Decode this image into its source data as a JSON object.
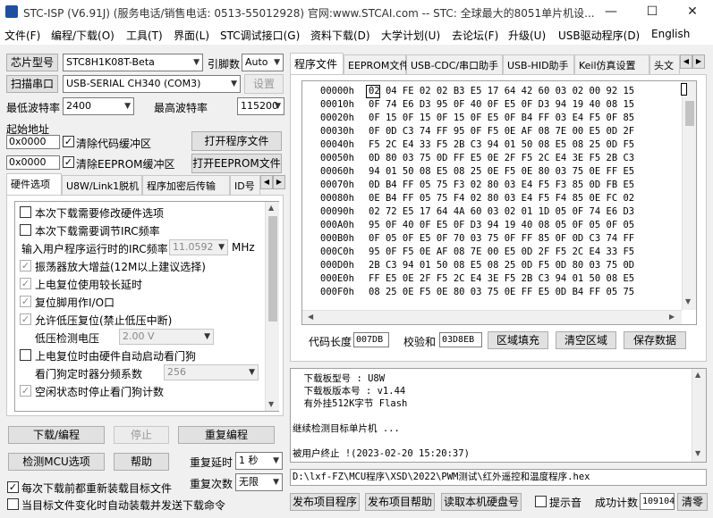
{
  "window": {
    "title": "STC-ISP (V6.91J) (服务电话/销售电话: 0513-55012928) 官网:www.STCAI.com  -- STC: 全球最大的8051单片机设...",
    "minimize_glyph": "—",
    "maximize_glyph": "☐",
    "close_glyph": "✕"
  },
  "menu": [
    "文件(F)",
    "编程/下载(O)",
    "工具(T)",
    "界面(L)",
    "STC调试接口(G)",
    "资料下载(D)",
    "大学计划(U)",
    "去论坛(F)",
    "升级(U)",
    "USB驱动程序(D)",
    "English"
  ],
  "left": {
    "chip_type_button": "芯片型号",
    "chip_type_value": "STC8H1K08T-Beta",
    "pin_count_label": "引脚数",
    "pin_count_value": "Auto",
    "scan_port_button": "扫描串口",
    "port_value": "USB-SERIAL CH340 (COM3)",
    "settings_button": "设置",
    "min_baud_label": "最低波特率",
    "min_baud_value": "2400",
    "max_baud_label": "最高波特率",
    "max_baud_value": "115200",
    "start_addr_label": "起始地址",
    "addr1_value": "0x0000",
    "clear_code_label": "清除代码缓冲区",
    "open_program_button": "打开程序文件",
    "addr2_value": "0x0000",
    "clear_eeprom_label": "清除EEPROM缓冲区",
    "open_eeprom_button": "打开EEPROM文件",
    "tabs": [
      "硬件选项",
      "U8W/Link1脱机",
      "程序加密后传输",
      "ID号"
    ],
    "options": {
      "opt1": "本次下载需要修改硬件选项",
      "opt2": "本次下载需要调节IRC频率",
      "irc_label": "输入用户程序运行时的IRC频率",
      "irc_value": "11.0592",
      "irc_unit": "MHz",
      "opt3": "振荡器放大增益(12M以上建议选择)",
      "opt4": "上电复位使用较长延时",
      "opt5": "复位脚用作I/O口",
      "opt6": "允许低压复位(禁止低压中断)",
      "lvd_label": "低压检测电压",
      "lvd_value": "2.00 V",
      "opt7": "上电复位时由硬件自动启动看门狗",
      "wdt_label": "看门狗定时器分频系数",
      "wdt_value": "256",
      "opt8": "空闲状态时停止看门狗计数"
    },
    "download_button": "下载/编程",
    "stop_button": "停止",
    "reprogram_button": "重复编程",
    "check_mcu_button": "检测MCU选项",
    "help_button": "帮助",
    "repeat_delay_label": "重复延时",
    "repeat_delay_value": "1 秒",
    "repeat_count_label": "重复次数",
    "repeat_count_value": "无限",
    "reload_label": "每次下载前都重新装载目标文件",
    "auto_load_label": "当目标文件变化时自动装载并发送下载命令"
  },
  "right": {
    "tabs": [
      "程序文件",
      "EEPROM文件",
      "USB-CDC/串口助手",
      "USB-HID助手",
      "Keil仿真设置",
      "头文"
    ],
    "hex_rows": [
      {
        "addr": "00000h",
        "bytes": "02 04 FE 02 02 B3 E5 17 64 42 60 03 02 00 92 15"
      },
      {
        "addr": "00010h",
        "bytes": "0F 74 E6 D3 95 0F 40 0F E5 0F D3 94 19 40 08 15"
      },
      {
        "addr": "00020h",
        "bytes": "0F 15 0F 15 0F 15 0F E5 0F B4 FF 03 E4 F5 0F 85"
      },
      {
        "addr": "00030h",
        "bytes": "0F 0D C3 74 FF 95 0F F5 0E AF 08 7E 00 E5 0D 2F"
      },
      {
        "addr": "00040h",
        "bytes": "F5 2C E4 33 F5 2B C3 94 01 50 08 E5 08 25 0D F5"
      },
      {
        "addr": "00050h",
        "bytes": "0D 80 03 75 0D FF E5 0E 2F F5 2C E4 3E F5 2B C3"
      },
      {
        "addr": "00060h",
        "bytes": "94 01 50 08 E5 08 25 0E F5 0E 80 03 75 0E FF E5"
      },
      {
        "addr": "00070h",
        "bytes": "0D B4 FF 05 75 F3 02 80 03 E4 F5 F3 85 0D FB E5"
      },
      {
        "addr": "00080h",
        "bytes": "0E B4 FF 05 75 F4 02 80 03 E4 F5 F4 85 0E FC 02"
      },
      {
        "addr": "00090h",
        "bytes": "02 72 E5 17 64 4A 60 03 02 01 1D 05 0F 74 E6 D3"
      },
      {
        "addr": "000A0h",
        "bytes": "95 0F 40 0F E5 0F D3 94 19 40 08 05 0F 05 0F 05"
      },
      {
        "addr": "000B0h",
        "bytes": "0F 05 0F E5 0F 70 03 75 0F FF 85 0F 0D C3 74 FF"
      },
      {
        "addr": "000C0h",
        "bytes": "95 0F F5 0E AF 08 7E 00 E5 0D 2F F5 2C E4 33 F5"
      },
      {
        "addr": "000D0h",
        "bytes": "2B C3 94 01 50 08 E5 08 25 0D F5 0D 80 03 75 0D"
      },
      {
        "addr": "000E0h",
        "bytes": "FF E5 0E 2F F5 2C E4 3E F5 2B C3 94 01 50 08 E5"
      },
      {
        "addr": "000F0h",
        "bytes": "08 25 0E F5 0E 80 03 75 0E FF E5 0D B4 FF 05 75"
      }
    ],
    "code_length_label": "代码长度",
    "code_length_value": "007DB",
    "checksum_label": "校验和",
    "checksum_value": "03D8EB",
    "fill_area_button": "区域填充",
    "clear_area_button": "清空区域",
    "save_data_button": "保存数据",
    "log_lines": [
      "  下载板型号 : U8W",
      "  下载板版本号 : v1.44",
      "  有外挂512K字节 Flash",
      "",
      "继续检测目标单片机 ...",
      "",
      "被用户终止 !(2023-02-20 15:20:37)"
    ],
    "file_path": "D:\\lxf-FZ\\MCU程序\\XSD\\2022\\PWM测试\\红外遥控和温度程序.hex",
    "publish_program_button": "发布项目程序",
    "publish_help_button": "发布项目帮助",
    "read_disk_button": "读取本机硬盘号",
    "beep_label": "提示音",
    "success_count_label": "成功计数",
    "success_count_value": "109104",
    "clear_button": "清零"
  }
}
